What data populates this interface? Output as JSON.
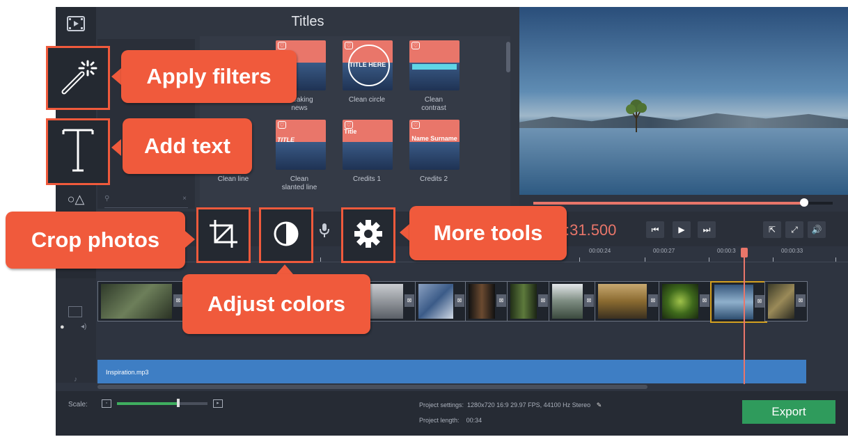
{
  "panel": {
    "title": "Titles",
    "search_placeholder": ""
  },
  "thumbnails": [
    {
      "caption": "Breaking\nnews",
      "text": ""
    },
    {
      "caption": "Clean circle",
      "text": "TITLE HERE"
    },
    {
      "caption": "Clean\ncontrast",
      "text": ""
    },
    {
      "caption": "Clean line",
      "text": ""
    },
    {
      "caption": "Clean\nslanted line",
      "text": "TITLE"
    },
    {
      "caption": "Credits 1",
      "text": "Title"
    },
    {
      "caption": "Credits 2",
      "text": "Name Surname"
    }
  ],
  "toolbar": {
    "timecode": ":31.500"
  },
  "ruler": {
    "ticks": [
      "00:00:24",
      "00:00:27",
      "00:00:3",
      "00:00:33"
    ]
  },
  "audio": {
    "filename": "Inspiration.mp3"
  },
  "bottom": {
    "scale_label": "Scale:",
    "scale_value": 0.68,
    "project_settings_label": "Project settings:",
    "project_settings_value": "1280x720 16:9 29.97 FPS, 44100 Hz Stereo",
    "project_length_label": "Project length:",
    "project_length_value": "00:34",
    "export_label": "Export"
  },
  "callouts": {
    "apply_filters": "Apply filters",
    "add_text": "Add text",
    "crop_photos": "Crop photos",
    "adjust_colors": "Adjust colors",
    "more_tools": "More tools"
  },
  "colors": {
    "callout": "#f05a3c",
    "export": "#2f9b5c",
    "accent": "#e9766a",
    "audio": "#3e7ec4"
  },
  "icons": [
    "film-icon",
    "magic-wand-icon",
    "text-icon",
    "crop-icon",
    "color-adjust-icon",
    "gear-icon",
    "microphone-icon",
    "skip-back-icon",
    "play-icon",
    "skip-forward-icon",
    "export-small-icon",
    "fullscreen-icon",
    "volume-icon",
    "pencil-icon"
  ]
}
